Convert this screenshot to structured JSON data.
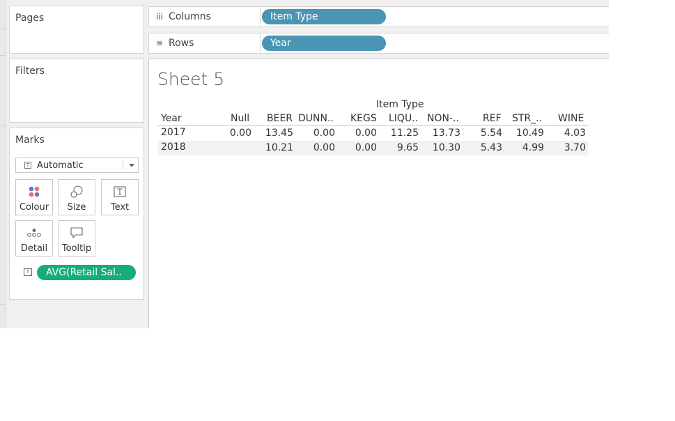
{
  "pages": {
    "title": "Pages"
  },
  "filters": {
    "title": "Filters"
  },
  "marks": {
    "title": "Marks",
    "mark_type": "Automatic",
    "buttons": [
      {
        "label": "Colour",
        "icon": "colour-dots-icon"
      },
      {
        "label": "Size",
        "icon": "size-shapes-icon"
      },
      {
        "label": "Text",
        "icon": "text-box-icon"
      },
      {
        "label": "Detail",
        "icon": "detail-dots-icon"
      },
      {
        "label": "Tooltip",
        "icon": "speech-bubble-icon"
      }
    ],
    "field": "AVG(Retail Sal.."
  },
  "shelves": {
    "columns": {
      "label": "Columns",
      "pill": "Item Type"
    },
    "rows": {
      "label": "Rows",
      "pill": "Year"
    }
  },
  "view": {
    "sheet_title": "Sheet 5",
    "column_group": "Item Type",
    "row_header": "Year",
    "columns": [
      "Null",
      "BEER",
      "DUNN..",
      "KEGS",
      "LIQU..",
      "NON-..",
      "REF",
      "STR_..",
      "WINE"
    ],
    "rows": [
      {
        "year": "2017",
        "values": [
          "0.00",
          "13.45",
          "0.00",
          "0.00",
          "11.25",
          "13.73",
          "5.54",
          "10.49",
          "4.03"
        ]
      },
      {
        "year": "2018",
        "values": [
          "",
          "10.21",
          "0.00",
          "0.00",
          "9.65",
          "10.30",
          "5.43",
          "4.99",
          "3.70"
        ]
      }
    ]
  },
  "colors": {
    "dimension_pill": "#4a95b4",
    "measure_pill": "#17ad77",
    "band": "#f2f2f2"
  }
}
